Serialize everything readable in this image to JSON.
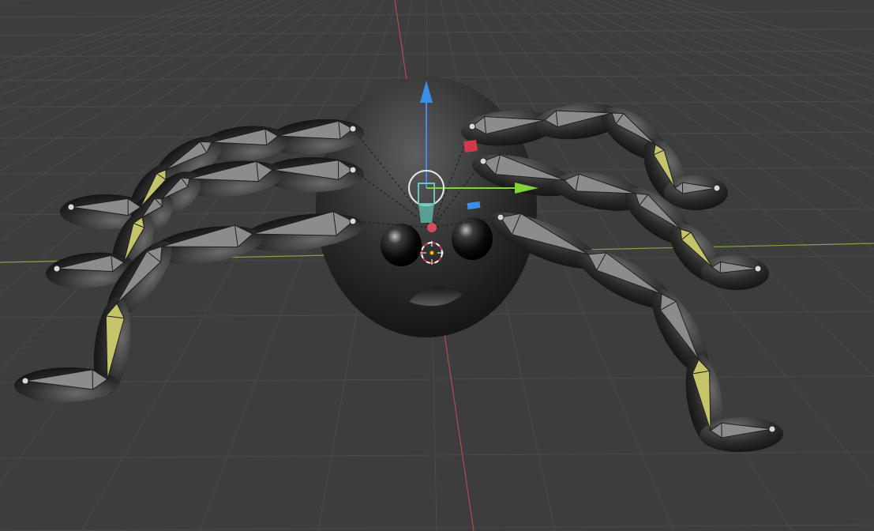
{
  "viewport": {
    "name": "3d-viewport",
    "colors": {
      "background": "#3d3d3d",
      "grid": "#4a4a4a",
      "x_axis": "#b34a58",
      "y_axis": "#7fa33b",
      "gizmo_z": "#3d8eea",
      "gizmo_y": "#80d13a",
      "gizmo_x": "#d2394d",
      "bone_fill": "#8c8c8c",
      "bone_selected": "#c6c46a",
      "active_bone": "#66c8b8",
      "joint": "#d8d8d8"
    }
  },
  "object": {
    "name": "spider",
    "parts": [
      "body",
      "left-eye",
      "right-eye",
      "mouth",
      "left-legs",
      "right-legs"
    ],
    "armature": "spider-armature",
    "leg_count": 8,
    "pose_mode": true
  },
  "gizmo": {
    "name": "transform-gizmo",
    "axes": [
      "z-arrow",
      "y-arrow",
      "x-plane-handle",
      "z-plane-handle"
    ],
    "has_center_circle": true
  },
  "cursor": {
    "name": "3d-cursor"
  }
}
